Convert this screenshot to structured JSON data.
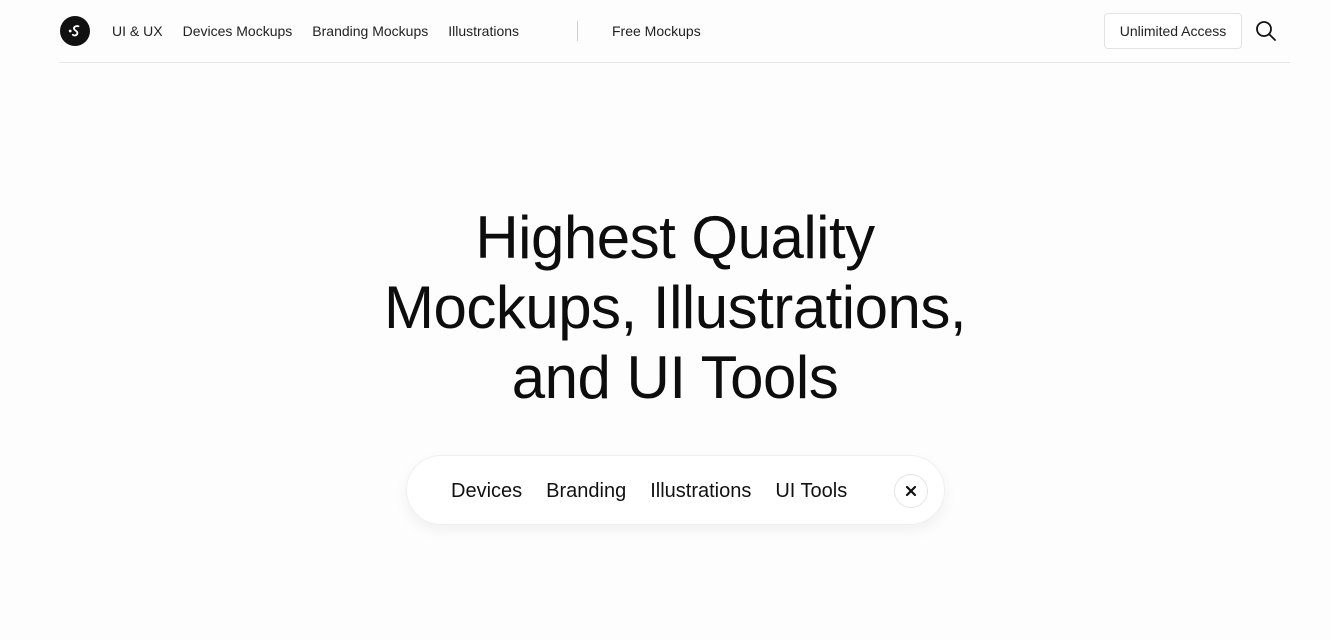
{
  "header": {
    "logo_icon": "brand-logo-icon",
    "nav": [
      {
        "label": "UI & UX"
      },
      {
        "label": "Devices Mockups"
      },
      {
        "label": "Branding Mockups"
      },
      {
        "label": "Illustrations"
      }
    ],
    "free_link": "Free Mockups",
    "access_button": "Unlimited Access",
    "search_icon": "search-icon"
  },
  "hero": {
    "title_lines": [
      "Highest Quality",
      "Mockups, Illustrations,",
      "and UI Tools"
    ]
  },
  "filters": {
    "items": [
      {
        "label": "Devices"
      },
      {
        "label": "Branding"
      },
      {
        "label": "Illustrations"
      },
      {
        "label": "UI Tools"
      }
    ],
    "close_icon": "close-icon"
  },
  "colors": {
    "background": "#fdfdfd",
    "text": "#111111",
    "border": "#e6e6e6"
  }
}
